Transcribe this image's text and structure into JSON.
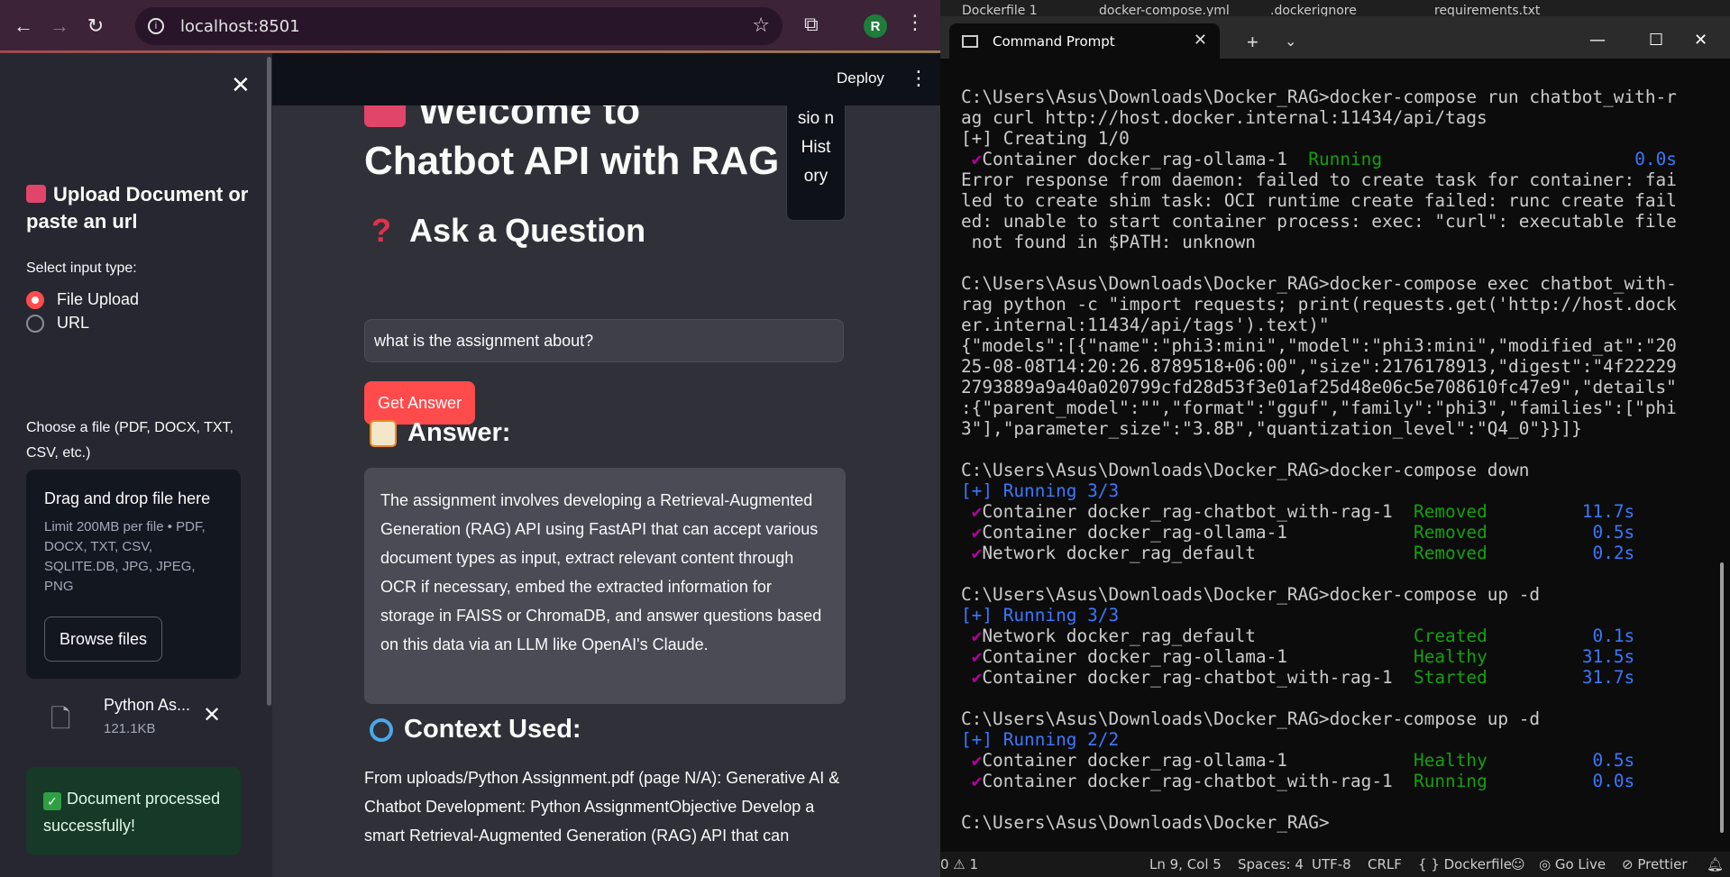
{
  "browser": {
    "url": "localhost:8501",
    "profile_initial": "R"
  },
  "sidebar": {
    "title": "Upload Document or paste an url",
    "input_type_label": "Select input type:",
    "options": [
      {
        "label": "File Upload",
        "selected": true
      },
      {
        "label": "URL",
        "selected": false
      }
    ],
    "file_label": "Choose a file (PDF, DOCX, TXT, CSV, etc.)",
    "dropzone_title": "Drag and drop file here",
    "dropzone_limit": "Limit 200MB per file • PDF, DOCX, TXT, CSV, SQLITE.DB, JPG, JPEG, PNG",
    "browse_label": "Browse files",
    "uploaded_file": {
      "name": "Python As...",
      "size": "121.1KB"
    },
    "success_message": "Document processed successfully!"
  },
  "main": {
    "deploy_label": "Deploy",
    "title": "Welcome to Chatbot API with RAG",
    "session_history": "sio n Hist ory",
    "ask_heading": "Ask a Question",
    "question_value": "what is the assignment about?",
    "get_answer_label": "Get Answer",
    "answer_heading": "Answer:",
    "answer_text": "The assignment involves developing a Retrieval-Augmented Generation (RAG) API using FastAPI that can accept various document types as input, extract relevant content through OCR if necessary, embed the extracted information for storage in FAISS or ChromaDB, and answer questions based on this data via an LLM like OpenAI's Claude.",
    "context_heading": "Context Used:",
    "context_text": "From uploads/Python Assignment.pdf (page N/A): Generative AI & Chatbot Development: Python AssignmentObjective Develop a smart Retrieval-Augmented Generation (RAG) API that can"
  },
  "terminal": {
    "background_tabs": [
      "Dockerfile 1",
      "docker-compose.yml",
      ".dockerignore",
      "requirements.txt"
    ],
    "tab_title": "Command Prompt",
    "lines": [
      {
        "t": "C:\\Users\\Asus\\Downloads\\Docker_RAG>docker-compose run chatbot_with-r",
        "c": ""
      },
      {
        "t": "ag curl http://host.docker.internal:11434/api/tags",
        "c": ""
      },
      {
        "t": "[+] Creating 1/0",
        "c": ""
      },
      {
        "t": " ✔Container docker_rag-ollama-1  Running                        0.0s",
        "c": "mix-running"
      },
      {
        "t": "Error response from daemon: failed to create task for container: fai",
        "c": ""
      },
      {
        "t": "led to create shim task: OCI runtime create failed: runc create fail",
        "c": ""
      },
      {
        "t": "ed: unable to start container process: exec: \"curl\": executable file",
        "c": ""
      },
      {
        "t": " not found in $PATH: unknown",
        "c": ""
      },
      {
        "t": "",
        "c": ""
      },
      {
        "t": "C:\\Users\\Asus\\Downloads\\Docker_RAG>docker-compose exec chatbot_with-",
        "c": ""
      },
      {
        "t": "rag python -c \"import requests; print(requests.get('http://host.dock",
        "c": ""
      },
      {
        "t": "er.internal:11434/api/tags').text)\"",
        "c": ""
      },
      {
        "t": "{\"models\":[{\"name\":\"phi3:mini\",\"model\":\"phi3:mini\",\"modified_at\":\"20",
        "c": ""
      },
      {
        "t": "25-08-08T14:20:26.8789518+06:00\",\"size\":2176178913,\"digest\":\"4f22229",
        "c": ""
      },
      {
        "t": "2793889a9a40a020799cfd28d53f3e01af25d48e06c5e708610fc47e9\",\"details\"",
        "c": ""
      },
      {
        "t": ":{\"parent_model\":\"\",\"format\":\"gguf\",\"family\":\"phi3\",\"families\":[\"phi",
        "c": ""
      },
      {
        "t": "3\"],\"parameter_size\":\"3.8B\",\"quantization_level\":\"Q4_0\"}}]}",
        "c": ""
      },
      {
        "t": "",
        "c": ""
      },
      {
        "t": "C:\\Users\\Asus\\Downloads\\Docker_RAG>docker-compose down",
        "c": ""
      },
      {
        "t": "[+] Running 3/3",
        "c": "blue"
      },
      {
        "t": " ✔Container docker_rag-chatbot_with-rag-1  Removed         11.7s",
        "c": "status"
      },
      {
        "t": " ✔Container docker_rag-ollama-1            Removed          0.5s",
        "c": "status"
      },
      {
        "t": " ✔Network docker_rag_default               Removed          0.2s",
        "c": "status"
      },
      {
        "t": "",
        "c": ""
      },
      {
        "t": "C:\\Users\\Asus\\Downloads\\Docker_RAG>docker-compose up -d",
        "c": ""
      },
      {
        "t": "[+] Running 3/3",
        "c": "blue"
      },
      {
        "t": " ✔Network docker_rag_default               Created          0.1s",
        "c": "status"
      },
      {
        "t": " ✔Container docker_rag-ollama-1            Healthy         31.5s",
        "c": "status"
      },
      {
        "t": " ✔Container docker_rag-chatbot_with-rag-1  Started         31.7s",
        "c": "status"
      },
      {
        "t": "",
        "c": ""
      },
      {
        "t": "C:\\Users\\Asus\\Downloads\\Docker_RAG>docker-compose up -d",
        "c": ""
      },
      {
        "t": "[+] Running 2/2",
        "c": "blue"
      },
      {
        "t": " ✔Container docker_rag-ollama-1            Healthy          0.5s",
        "c": "status"
      },
      {
        "t": " ✔Container docker_rag-chatbot_with-rag-1  Running          0.0s",
        "c": "status"
      },
      {
        "t": "",
        "c": ""
      },
      {
        "t": "C:\\Users\\Asus\\Downloads\\Docker_RAG>",
        "c": ""
      }
    ]
  },
  "statusbar": {
    "problems": "0 ⚠ 1",
    "position": "Ln 9, Col 5",
    "spaces": "Spaces: 4",
    "encoding": "UTF-8",
    "eol": "CRLF",
    "language": "{ } Dockerfile",
    "go_live": "Go Live",
    "prettier": "Prettier"
  },
  "colors": {
    "streamlit_red": "#ff4b4b",
    "terminal_green": "#13a10e",
    "terminal_blue": "#3b78ff",
    "check_purple": "#b4009e"
  }
}
